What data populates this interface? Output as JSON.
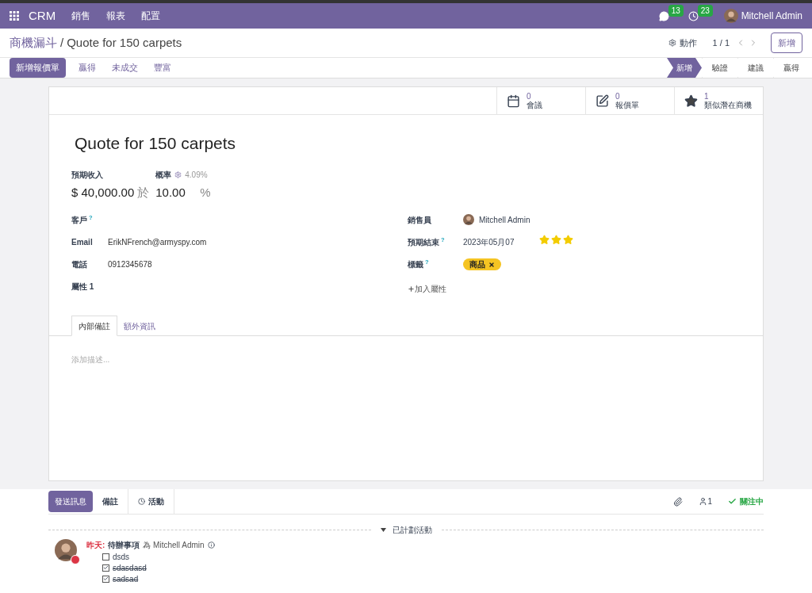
{
  "navbar": {
    "app": "CRM",
    "menus": [
      "銷售",
      "報表",
      "配置"
    ],
    "messages_count": "13",
    "activities_count": "23",
    "user": "Mitchell Admin"
  },
  "breadcrumb": {
    "parent": "商機漏斗",
    "separator": "/",
    "current": "Quote for 150 carpets"
  },
  "control": {
    "action": "動作",
    "pager": "1 / 1",
    "new": "新增"
  },
  "buttons": [
    {
      "label": "新增報價單",
      "kind": "primary"
    },
    {
      "label": "贏得",
      "kind": "link"
    },
    {
      "label": "未成交",
      "kind": "link"
    },
    {
      "label": "豐富",
      "kind": "link"
    }
  ],
  "stages": [
    {
      "label": "新增",
      "selected": true
    },
    {
      "label": "驗證",
      "selected": false
    },
    {
      "label": "建議",
      "selected": false
    },
    {
      "label": "贏得",
      "selected": false
    }
  ],
  "smart_buttons": [
    {
      "kind": "calendar",
      "count": "0",
      "label": "會議"
    },
    {
      "kind": "edit",
      "count": "0",
      "label": "報價單"
    },
    {
      "kind": "star",
      "count": "1",
      "label": "類似潛在商機"
    }
  ],
  "title": "Quote for 150 carpets",
  "revenue": {
    "label": "預期收入",
    "value": "$ 40,000.00",
    "at": "於"
  },
  "probability": {
    "label": "概率",
    "auto": "4.09%",
    "value": "10.00",
    "unit": "%"
  },
  "left_fields": [
    {
      "label": "客戶",
      "help": "?"
    },
    {
      "label": "Email",
      "value": "ErikNFrench@armyspy.com"
    },
    {
      "label": "電話",
      "value": "0912345678"
    },
    {
      "label": "屬性 1"
    }
  ],
  "salesperson": {
    "label": "銷售員",
    "value": "Mitchell Admin"
  },
  "deadline": {
    "label": "預期結束",
    "help": "?",
    "value": "2023年05月07",
    "stars": 3
  },
  "tags": {
    "label": "標籤",
    "help": "?",
    "items": [
      {
        "label": "商品",
        "color": "#f5c423"
      }
    ]
  },
  "add_property": "加入屬性",
  "tabs": [
    {
      "label": "內部備註",
      "selected": true
    },
    {
      "label": "額外資訊",
      "selected": false
    }
  ],
  "description_placeholder": "添加描述...",
  "chatter": {
    "send": "發送訊息",
    "tabs": [
      {
        "label": "備註",
        "kind": "plain"
      },
      {
        "label": "活動",
        "kind": "clock"
      }
    ],
    "followers": "1",
    "following": "關注中",
    "planned": "已計劃活動",
    "activity": {
      "when": "昨天:",
      "type": "待辦事項",
      "for": "為 Mitchell Admin",
      "items": [
        {
          "label": "dsds",
          "checked": false
        },
        {
          "label": "sdasdasd",
          "checked": true
        },
        {
          "label": "sadsad",
          "checked": true
        }
      ]
    }
  }
}
